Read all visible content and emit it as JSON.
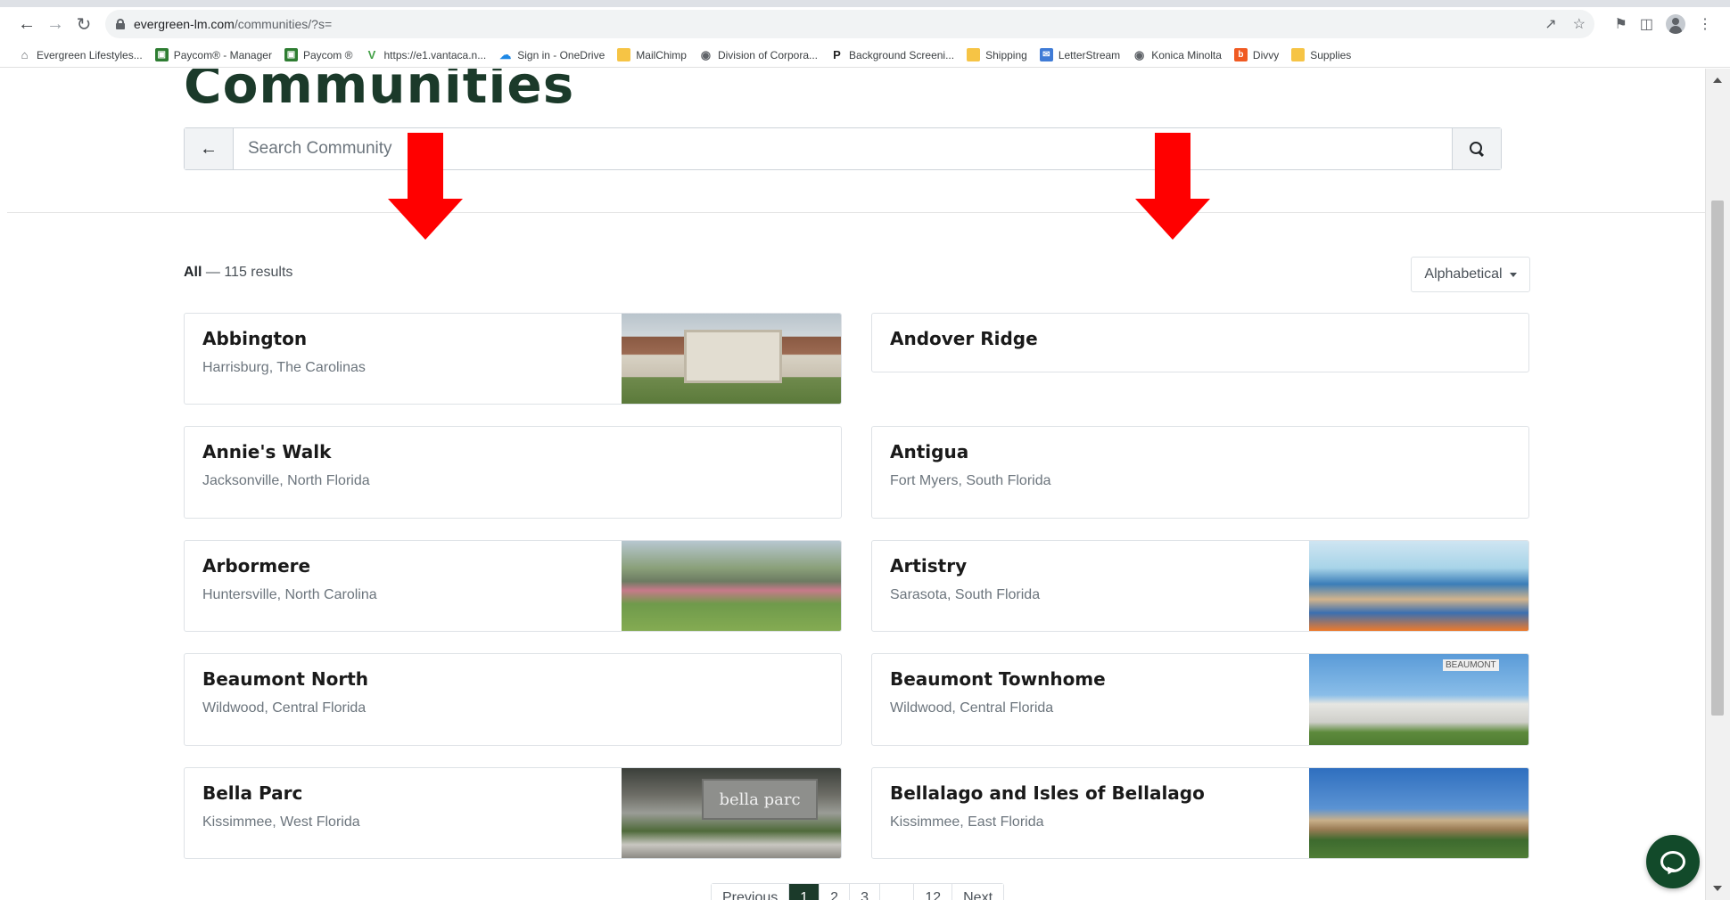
{
  "browser": {
    "url_host": "evergreen-lm.com",
    "url_path": "/communities/?s=",
    "bookmarks": [
      {
        "label": "Evergreen Lifestyles...",
        "icon": "house-icon",
        "color": "#5f6368"
      },
      {
        "label": "Paycom® - Manager",
        "icon": "paycom-icon",
        "color": "#2e7d32"
      },
      {
        "label": "Paycom ®",
        "icon": "paycom-icon",
        "color": "#2e7d32"
      },
      {
        "label": "https://e1.vantaca.n...",
        "icon": "vantaca-icon",
        "color": "#43a047"
      },
      {
        "label": "Sign in - OneDrive",
        "icon": "cloud-icon",
        "color": "#1e88e5"
      },
      {
        "label": "MailChimp",
        "icon": "folder-icon",
        "color": "#f6c445"
      },
      {
        "label": "Division of Corpora...",
        "icon": "globe-icon",
        "color": "#5f6368"
      },
      {
        "label": "Background Screeni...",
        "icon": "p-icon",
        "color": "#222222"
      },
      {
        "label": "Shipping",
        "icon": "folder-icon",
        "color": "#f6c445"
      },
      {
        "label": "LetterStream",
        "icon": "letterstream-icon",
        "color": "#3f7bd6"
      },
      {
        "label": "Konica Minolta",
        "icon": "globe-icon",
        "color": "#5f6368"
      },
      {
        "label": "Divvy",
        "icon": "divvy-icon",
        "color": "#f05a22"
      },
      {
        "label": "Supplies",
        "icon": "folder-icon",
        "color": "#f6c445"
      }
    ]
  },
  "page": {
    "heading": "Communities",
    "search_placeholder": "Search Community",
    "results_prefix": "All",
    "results_suffix": " — 115 results",
    "sort_label": "Alphabetical",
    "brand_color": "#1b3a2a",
    "arrow_color": "#ff0000"
  },
  "communities": [
    {
      "name": "Abbington",
      "location": "Harrisburg, The Carolinas",
      "has_photo": true
    },
    {
      "name": "Andover Ridge",
      "location": "",
      "has_photo": false
    },
    {
      "name": "Annie's Walk",
      "location": "Jacksonville, North Florida",
      "has_photo": false
    },
    {
      "name": "Antigua",
      "location": "Fort Myers, South Florida",
      "has_photo": false
    },
    {
      "name": "Arbormere",
      "location": "Huntersville, North Carolina",
      "has_photo": true
    },
    {
      "name": "Artistry",
      "location": "Sarasota, South Florida",
      "has_photo": true
    },
    {
      "name": "Beaumont North",
      "location": "Wildwood, Central Florida",
      "has_photo": false
    },
    {
      "name": "Beaumont Townhome",
      "location": "Wildwood, Central Florida",
      "has_photo": true
    },
    {
      "name": "Bella Parc",
      "location": "Kissimmee, West Florida",
      "has_photo": true
    },
    {
      "name": "Bellalago and Isles of Bellalago",
      "location": "Kissimmee, East Florida",
      "has_photo": true
    }
  ],
  "photo_text": {
    "beaumont_sign": "BEAUMONT",
    "bellaparc_sign": "bella parc"
  },
  "pagination": {
    "previous": "Previous",
    "pages": [
      "1",
      "2",
      "3",
      "...",
      "12"
    ],
    "active_page": "1",
    "next": "Next"
  }
}
